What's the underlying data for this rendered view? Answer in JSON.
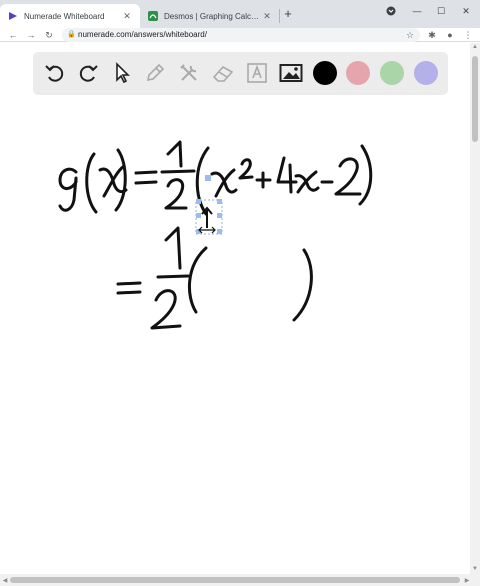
{
  "browser": {
    "tabs": [
      {
        "title": "Numerade Whiteboard",
        "active": true,
        "favicon_color": "#5b3cc4"
      },
      {
        "title": "Desmos | Graphing Calculator",
        "active": false,
        "favicon_color": "#2f8f46"
      }
    ],
    "url": "numerade.com/answers/whiteboard/"
  },
  "whiteboard": {
    "tools": [
      "undo-icon",
      "redo-icon",
      "pointer-icon",
      "pencil-icon",
      "tools-icon",
      "eraser-icon",
      "text-icon",
      "image-icon"
    ],
    "colors": [
      "#000000",
      "#e6a5ad",
      "#a9d5a8",
      "#b3b0ea"
    ],
    "selected_color": "#000000"
  }
}
